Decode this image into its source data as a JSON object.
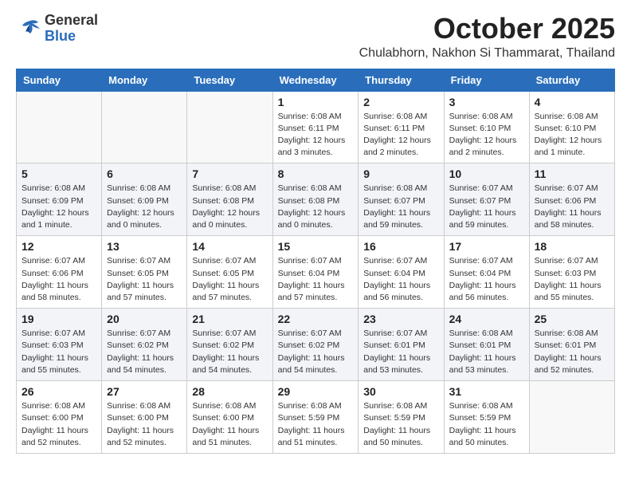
{
  "header": {
    "logo_general": "General",
    "logo_blue": "Blue",
    "title": "October 2025",
    "subtitle": "Chulabhorn, Nakhon Si Thammarat, Thailand"
  },
  "weekdays": [
    "Sunday",
    "Monday",
    "Tuesday",
    "Wednesday",
    "Thursday",
    "Friday",
    "Saturday"
  ],
  "weeks": [
    [
      {
        "day": "",
        "info": ""
      },
      {
        "day": "",
        "info": ""
      },
      {
        "day": "",
        "info": ""
      },
      {
        "day": "1",
        "info": "Sunrise: 6:08 AM\nSunset: 6:11 PM\nDaylight: 12 hours\nand 3 minutes."
      },
      {
        "day": "2",
        "info": "Sunrise: 6:08 AM\nSunset: 6:11 PM\nDaylight: 12 hours\nand 2 minutes."
      },
      {
        "day": "3",
        "info": "Sunrise: 6:08 AM\nSunset: 6:10 PM\nDaylight: 12 hours\nand 2 minutes."
      },
      {
        "day": "4",
        "info": "Sunrise: 6:08 AM\nSunset: 6:10 PM\nDaylight: 12 hours\nand 1 minute."
      }
    ],
    [
      {
        "day": "5",
        "info": "Sunrise: 6:08 AM\nSunset: 6:09 PM\nDaylight: 12 hours\nand 1 minute."
      },
      {
        "day": "6",
        "info": "Sunrise: 6:08 AM\nSunset: 6:09 PM\nDaylight: 12 hours\nand 0 minutes."
      },
      {
        "day": "7",
        "info": "Sunrise: 6:08 AM\nSunset: 6:08 PM\nDaylight: 12 hours\nand 0 minutes."
      },
      {
        "day": "8",
        "info": "Sunrise: 6:08 AM\nSunset: 6:08 PM\nDaylight: 12 hours\nand 0 minutes."
      },
      {
        "day": "9",
        "info": "Sunrise: 6:08 AM\nSunset: 6:07 PM\nDaylight: 11 hours\nand 59 minutes."
      },
      {
        "day": "10",
        "info": "Sunrise: 6:07 AM\nSunset: 6:07 PM\nDaylight: 11 hours\nand 59 minutes."
      },
      {
        "day": "11",
        "info": "Sunrise: 6:07 AM\nSunset: 6:06 PM\nDaylight: 11 hours\nand 58 minutes."
      }
    ],
    [
      {
        "day": "12",
        "info": "Sunrise: 6:07 AM\nSunset: 6:06 PM\nDaylight: 11 hours\nand 58 minutes."
      },
      {
        "day": "13",
        "info": "Sunrise: 6:07 AM\nSunset: 6:05 PM\nDaylight: 11 hours\nand 57 minutes."
      },
      {
        "day": "14",
        "info": "Sunrise: 6:07 AM\nSunset: 6:05 PM\nDaylight: 11 hours\nand 57 minutes."
      },
      {
        "day": "15",
        "info": "Sunrise: 6:07 AM\nSunset: 6:04 PM\nDaylight: 11 hours\nand 57 minutes."
      },
      {
        "day": "16",
        "info": "Sunrise: 6:07 AM\nSunset: 6:04 PM\nDaylight: 11 hours\nand 56 minutes."
      },
      {
        "day": "17",
        "info": "Sunrise: 6:07 AM\nSunset: 6:04 PM\nDaylight: 11 hours\nand 56 minutes."
      },
      {
        "day": "18",
        "info": "Sunrise: 6:07 AM\nSunset: 6:03 PM\nDaylight: 11 hours\nand 55 minutes."
      }
    ],
    [
      {
        "day": "19",
        "info": "Sunrise: 6:07 AM\nSunset: 6:03 PM\nDaylight: 11 hours\nand 55 minutes."
      },
      {
        "day": "20",
        "info": "Sunrise: 6:07 AM\nSunset: 6:02 PM\nDaylight: 11 hours\nand 54 minutes."
      },
      {
        "day": "21",
        "info": "Sunrise: 6:07 AM\nSunset: 6:02 PM\nDaylight: 11 hours\nand 54 minutes."
      },
      {
        "day": "22",
        "info": "Sunrise: 6:07 AM\nSunset: 6:02 PM\nDaylight: 11 hours\nand 54 minutes."
      },
      {
        "day": "23",
        "info": "Sunrise: 6:07 AM\nSunset: 6:01 PM\nDaylight: 11 hours\nand 53 minutes."
      },
      {
        "day": "24",
        "info": "Sunrise: 6:08 AM\nSunset: 6:01 PM\nDaylight: 11 hours\nand 53 minutes."
      },
      {
        "day": "25",
        "info": "Sunrise: 6:08 AM\nSunset: 6:01 PM\nDaylight: 11 hours\nand 52 minutes."
      }
    ],
    [
      {
        "day": "26",
        "info": "Sunrise: 6:08 AM\nSunset: 6:00 PM\nDaylight: 11 hours\nand 52 minutes."
      },
      {
        "day": "27",
        "info": "Sunrise: 6:08 AM\nSunset: 6:00 PM\nDaylight: 11 hours\nand 52 minutes."
      },
      {
        "day": "28",
        "info": "Sunrise: 6:08 AM\nSunset: 6:00 PM\nDaylight: 11 hours\nand 51 minutes."
      },
      {
        "day": "29",
        "info": "Sunrise: 6:08 AM\nSunset: 5:59 PM\nDaylight: 11 hours\nand 51 minutes."
      },
      {
        "day": "30",
        "info": "Sunrise: 6:08 AM\nSunset: 5:59 PM\nDaylight: 11 hours\nand 50 minutes."
      },
      {
        "day": "31",
        "info": "Sunrise: 6:08 AM\nSunset: 5:59 PM\nDaylight: 11 hours\nand 50 minutes."
      },
      {
        "day": "",
        "info": ""
      }
    ]
  ]
}
